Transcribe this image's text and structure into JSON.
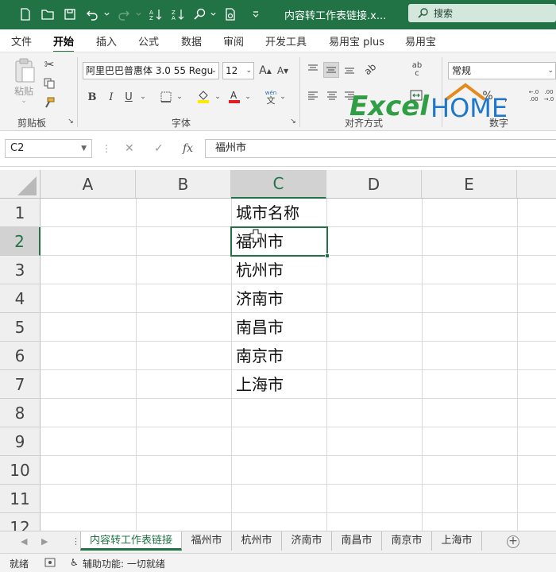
{
  "window": {
    "title": "内容转工作表链接.x...",
    "search_placeholder": "搜索"
  },
  "ribbon_tabs": [
    "文件",
    "开始",
    "插入",
    "公式",
    "数据",
    "审阅",
    "开发工具",
    "易用宝 plus",
    "易用宝"
  ],
  "active_ribbon_tab": "开始",
  "ribbon": {
    "paste_label": "粘贴",
    "clipboard_label": "剪贴板",
    "font_name": "阿里巴巴普惠体 3.0 55 Regu",
    "font_size": "12",
    "font_group_label": "字体",
    "align_group_label": "对齐方式",
    "number_format": "常规",
    "number_group_label": "数字",
    "wen_label": "wén",
    "wen_char": "文",
    "ab_label": "ab",
    "c_label": "c"
  },
  "logo": {
    "text_left": "Excel",
    "text_right": "HOME"
  },
  "formula_bar": {
    "name_box": "C2",
    "formula": "福州市"
  },
  "columns": [
    "A",
    "B",
    "C",
    "D",
    "E"
  ],
  "rows": [
    "1",
    "2",
    "3",
    "4",
    "5",
    "6",
    "7",
    "8",
    "9",
    "10",
    "11",
    "12"
  ],
  "selected": {
    "column": "C",
    "row": "2"
  },
  "cells": {
    "C1": "城市名称",
    "C2": "福州市",
    "C3": "杭州市",
    "C4": "济南市",
    "C5": "南昌市",
    "C6": "南京市",
    "C7": "上海市"
  },
  "sheet_tabs": [
    "内容转工作表链接",
    "福州市",
    "杭州市",
    "济南市",
    "南昌市",
    "南京市",
    "上海市"
  ],
  "active_sheet": "内容转工作表链接",
  "status": {
    "ready": "就绪",
    "accessibility": "辅助功能: 一切就绪"
  },
  "colors": {
    "accent": "#217346"
  }
}
